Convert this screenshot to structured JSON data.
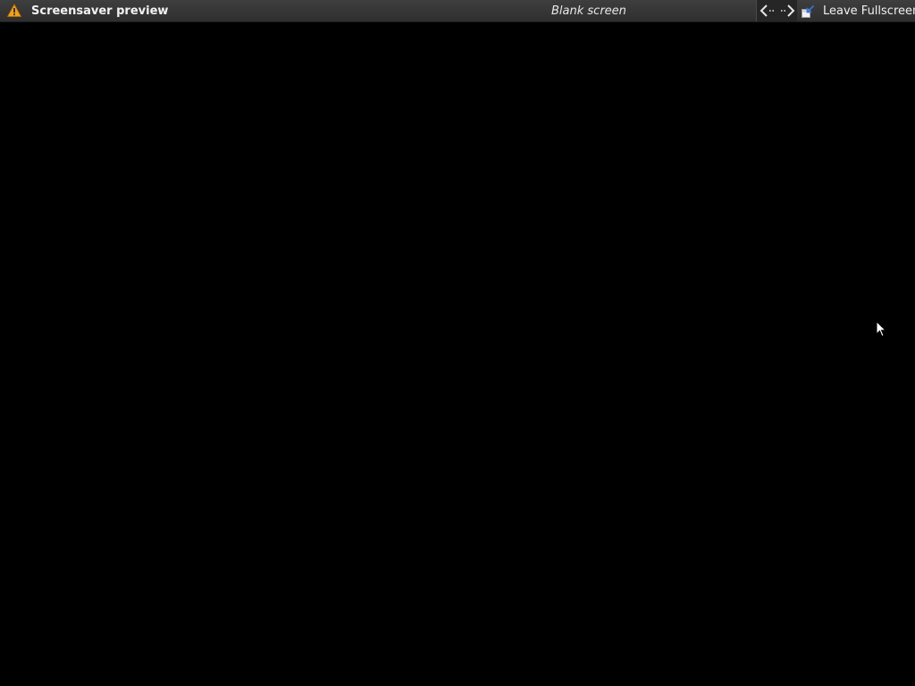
{
  "window": {
    "title": "Screensaver preview",
    "subtitle": "Blank screen",
    "icon": "warning-icon"
  },
  "toolbar": {
    "prev_icon": "arrow-left-icon",
    "next_icon": "arrow-right-icon",
    "leave_fullscreen_label": "Leave Fullscreen",
    "leave_fullscreen_icon": "leave-fullscreen-icon"
  },
  "colors": {
    "topbar": "#353535",
    "background": "#000000",
    "warning": "#f0a020",
    "accent_blue": "#3a6fd8"
  }
}
